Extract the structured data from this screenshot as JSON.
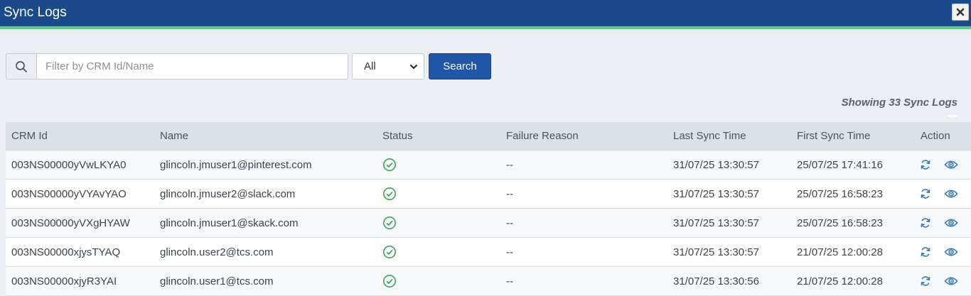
{
  "window": {
    "title": "Sync Logs",
    "close_icon": "close-icon"
  },
  "filter": {
    "search_icon": "search-icon",
    "placeholder": "Filter by CRM Id/Name",
    "value": "",
    "status_selected": "All",
    "search_label": "Search"
  },
  "summary": "Showing 33 Sync Logs",
  "table": {
    "columns": [
      "CRM Id",
      "Name",
      "Status",
      "Failure Reason",
      "Last Sync Time",
      "First Sync Time",
      "Action"
    ],
    "rows": [
      {
        "crm_id": "003NS00000yVwLKYA0",
        "name": "glincoln.jmuser1@pinterest.com",
        "status": "success",
        "failure": "--",
        "last_sync": "31/07/25 13:30:57",
        "first_sync": "25/07/25 17:41:16"
      },
      {
        "crm_id": "003NS00000yVYAvYAO",
        "name": "glincoln.jmuser2@slack.com",
        "status": "success",
        "failure": "--",
        "last_sync": "31/07/25 13:30:57",
        "first_sync": "25/07/25 16:58:23"
      },
      {
        "crm_id": "003NS00000yVXgHYAW",
        "name": "glincoln.jmuser1@skack.com",
        "status": "success",
        "failure": "--",
        "last_sync": "31/07/25 13:30:57",
        "first_sync": "25/07/25 16:58:23"
      },
      {
        "crm_id": "003NS00000xjysTYAQ",
        "name": "glincoln.user2@tcs.com",
        "status": "success",
        "failure": "--",
        "last_sync": "31/07/25 13:30:57",
        "first_sync": "21/07/25 12:00:28"
      },
      {
        "crm_id": "003NS00000xjyR3YAI",
        "name": "glincoln.user1@tcs.com",
        "status": "success",
        "failure": "--",
        "last_sync": "31/07/25 13:30:56",
        "first_sync": "21/07/25 12:00:28"
      }
    ]
  },
  "colors": {
    "header_bg": "#1b4a8c",
    "accent_line": "#5ccb7e",
    "button": "#1f56a5",
    "success": "#3aa757",
    "action_icon": "#2f78b9"
  }
}
